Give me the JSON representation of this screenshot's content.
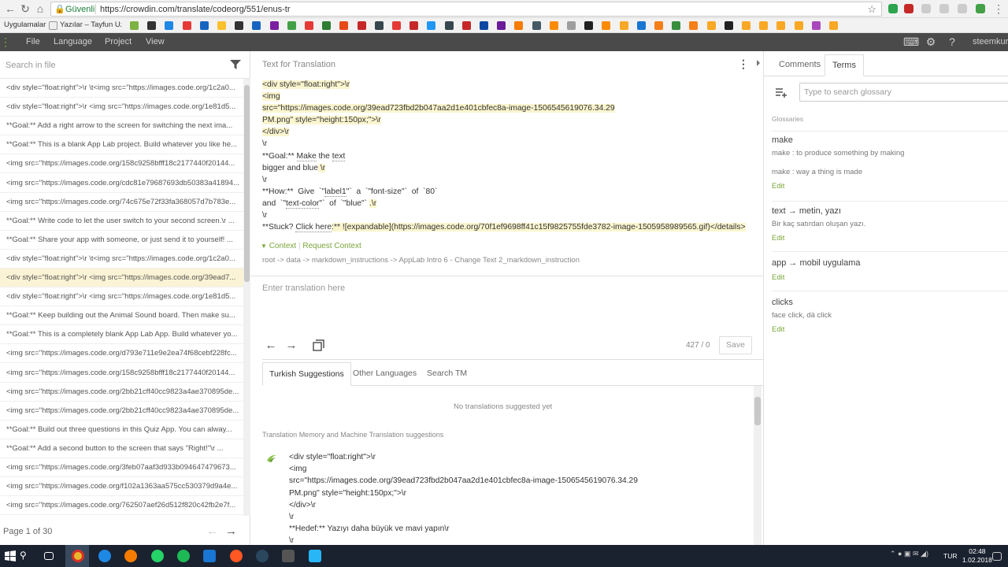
{
  "browser": {
    "secure_label": "Güvenli",
    "url": "https://crowdin.com/translate/codeorg/551/enus-tr"
  },
  "bookmarks": {
    "apps_label": "Uygulamalar",
    "item1_label": "Yazılar – Tayfun Uzun"
  },
  "menu": {
    "file": "File",
    "language": "Language",
    "project": "Project",
    "view": "View",
    "user": "steemkurd"
  },
  "left_panel": {
    "search_placeholder": "Search in file",
    "strings": [
      "<div style=\"float:right\">\\r \\t<img src=\"https://images.code.org/1c2a0...",
      "<div style=\"float:right\">\\r <img src=\"https://images.code.org/1e81d5...",
      "**Goal:** Add a right arrow to the screen for switching the next ima...",
      "**Goal:** This is a blank App Lab project. Build whatever you like he...",
      "<img src=\"https://images.code.org/158c9258bfff18c2177440f20144...",
      "<img src=\"https://images.code.org/cdc81e79687693db50383a41894...",
      "<img src=\"https://images.code.org/74c675e72f33fa368057d7b783e...",
      "**Goal:** Write code to let the user switch to your second screen.\\r ...",
      "**Goal:** Share your app with someone, or just send it to yourself! ...",
      "<div style=\"float:right\">\\r \\t<img src=\"https://images.code.org/1c2a0...",
      "<div style=\"float:right\">\\r <img src=\"https://images.code.org/39ead7...",
      "<div style=\"float:right\">\\r <img src=\"https://images.code.org/1e81d5...",
      "**Goal:** Keep building out the Animal Sound board. Then make su...",
      "**Goal:** This is a completely blank App Lab App. Build whatever yo...",
      "<img src=\"https://images.code.org/d793e711e9e2ea74f68cebf228fc...",
      "<img src=\"https://images.code.org/158c9258bfff18c2177440f20144...",
      "<img src=\"https://images.code.org/2bb21cff40cc9823a4ae370895de...",
      "<img src=\"https://images.code.org/2bb21cff40cc9823a4ae370895de...",
      "**Goal:** Build out three questions in this Quiz App. You can alway...",
      "**Goal:** Add a second button to the screen that says \"Right!\"\\r ...",
      "<img src=\"https://images.code.org/3feb07aaf3d933b094647479673...",
      "<img src=\"https://images.code.org/f102a1363aa575cc530379d9a4e...",
      "<img src=\"https://images.code.org/762507aef26d512f820c42fb2e7f..."
    ],
    "page_info": "Page 1 of 30"
  },
  "editor": {
    "heading": "Text for Translation",
    "source_lines": {
      "l1": "<div style=\"float:right\">\\r",
      "l2": "<img",
      "l3": "src=\"https://images.code.org/39ead723fbd2b047aa2d1e401cbfec8a-image-1506545619076.34.29",
      "l4": "PM.png\" style=\"height:150px;\">\\r",
      "l5": "</div>\\r",
      "l6": "\\r",
      "l7a": "**Goal:** ",
      "l7b": "Make",
      "l7c": " the ",
      "l7d": "text",
      "l8a": "bigger and blue",
      "l8b": " \\r",
      "l9": "\\r",
      "l10a": "**How:**  Give  `\"",
      "l10b": "label1",
      "l10c": "\"`  a  `\"font-size\"`  of  `80`",
      "l11a": "and  `\"",
      "l11b": "text-color",
      "l11c": "\"`  of  `\"blue\"` ",
      "l11d": ".\\r",
      "l12": "\\r",
      "l13a": "**Stuck? ",
      "l13b": "Click here",
      "l13c": ":** ![expandable](https://images.code.org/70f1ef9698ff41c15f9825755fde3782-image-1505958989565.gif)</details>"
    },
    "context_label": "Context",
    "request_context_label": "Request Context",
    "context_path": "root -> data -> markdown_instructions -> AppLab Intro 6 - Change Text 2_markdown_instruction",
    "translation_placeholder": "Enter translation here",
    "counter": "427 / 0",
    "save_label": "Save"
  },
  "suggestions": {
    "tabs": [
      "Turkish Suggestions",
      "Other Languages",
      "Search TM"
    ],
    "no_suggestions": "No translations suggested yet",
    "tm_label": "Translation Memory and Machine Translation suggestions",
    "tm_lines": [
      "<div style=\"float:right\">\\r",
      "<img",
      "src=\"https://images.code.org/39ead723fbd2b047aa2d1e401cbfec8a-image-1506545619076.34.29",
      "PM.png\" style=\"height:150px;\">\\r",
      "</div>\\r",
      "\\r",
      "**Hedef:** Yazıyı daha büyük ve mavi yapın\\r",
      "\\r"
    ]
  },
  "right_panel": {
    "tabs": [
      "Comments",
      "Terms"
    ],
    "search_placeholder": "Type to search glossary",
    "glossaries_label": "Glossaries",
    "edit_label": "Edit",
    "terms": [
      {
        "title": "make",
        "desc1": "make : to produce something by making",
        "desc2": "make : way a thing is made"
      },
      {
        "title": "text → metin, yazı",
        "desc1": "Bir kaç satırdan oluşan yazı."
      },
      {
        "title": "app → mobil uygulama"
      },
      {
        "title": "clicks",
        "desc1": "face click, dä click"
      }
    ]
  },
  "taskbar": {
    "language": "TUR",
    "time": "02:48",
    "date": "1.02.2018"
  },
  "colors": {
    "menubar": "#4a4a4a",
    "highlight_row": "#fbf3d5",
    "tag_highlight": "#fbf5cf",
    "link_green": "#7aa63b",
    "taskbar": "#1a2230"
  }
}
